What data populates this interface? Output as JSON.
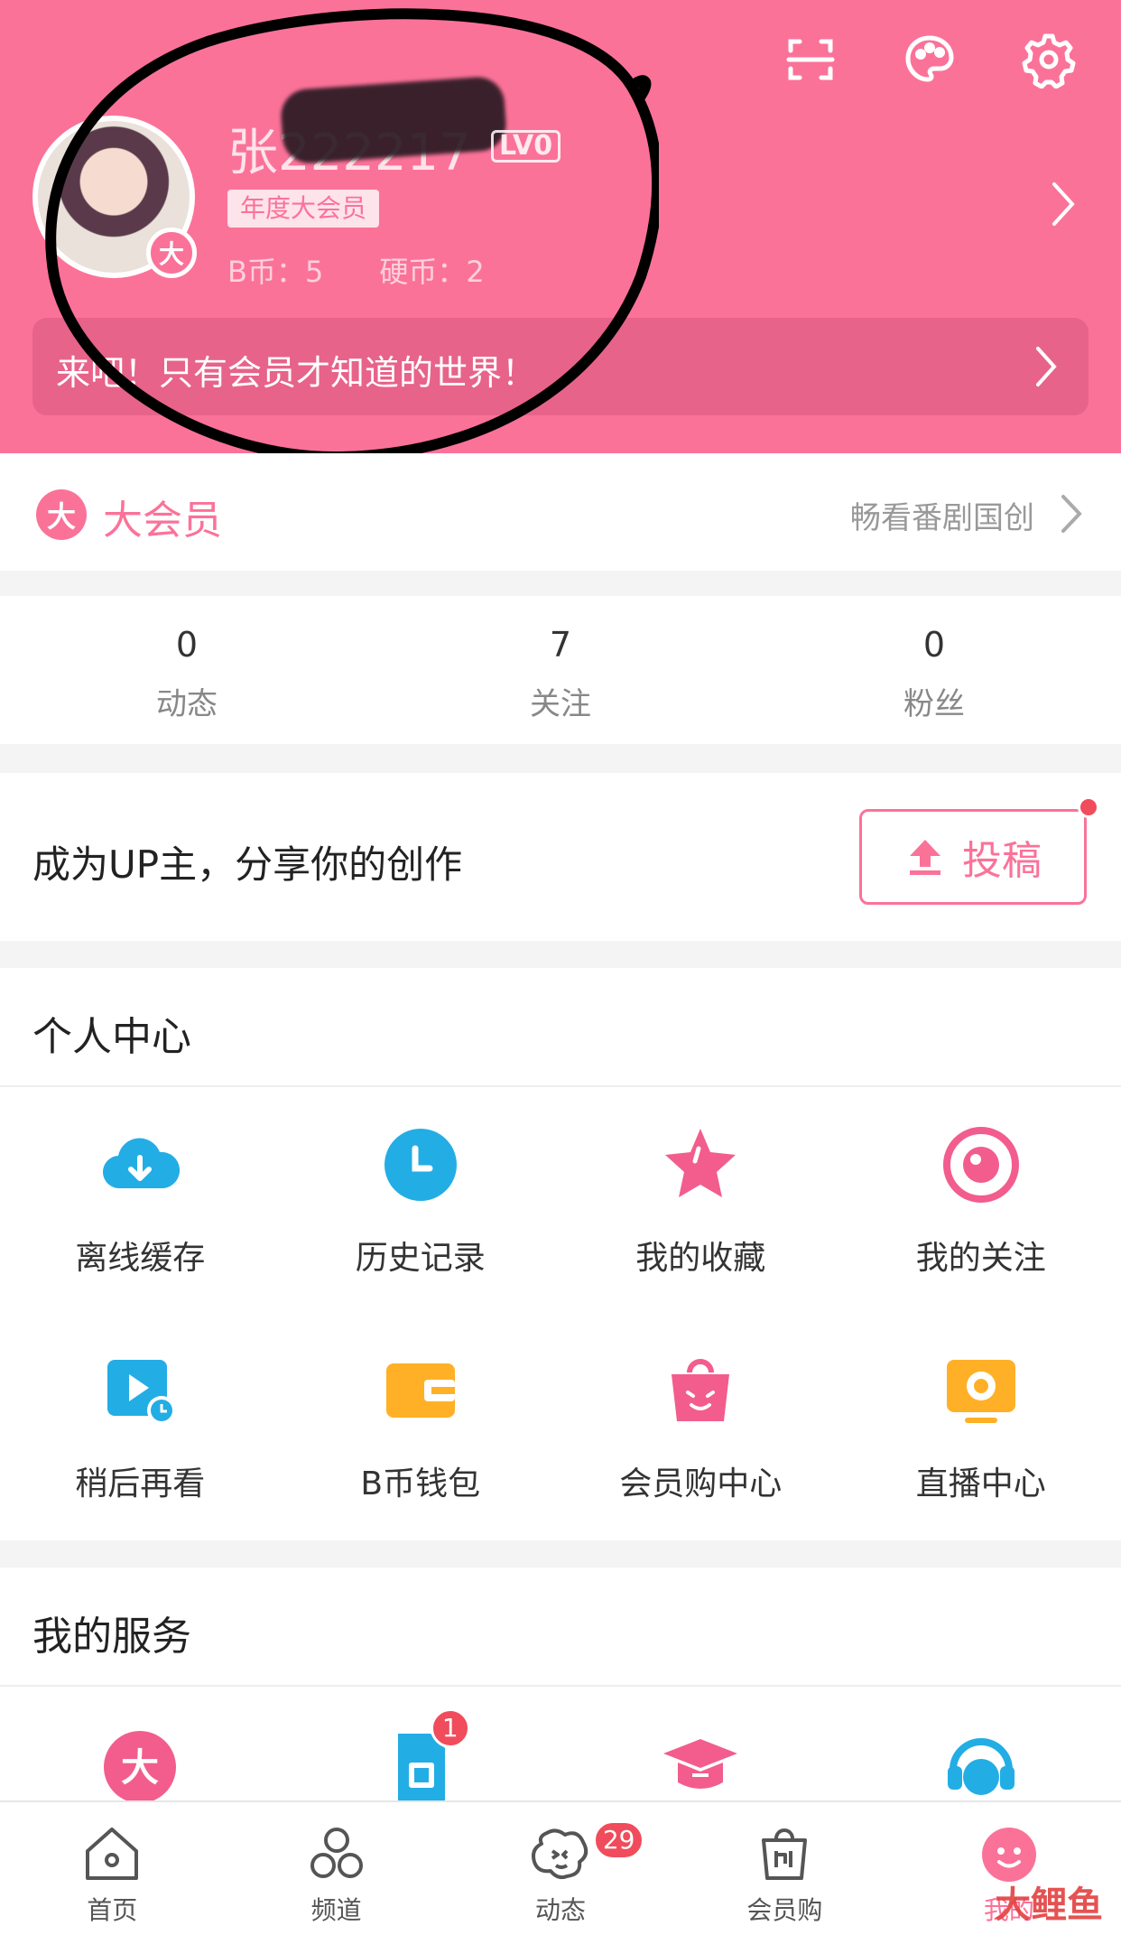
{
  "header": {
    "username": "张222217",
    "level": "LV0",
    "vip_tag": "年度大会员",
    "bcoin": "B币：5",
    "hardcoin": "硬币：2",
    "promo": "来吧！只有会员才知道的世界！",
    "avatar_badge": "大"
  },
  "vip_row": {
    "icon_text": "大",
    "title": "大会员",
    "subtitle": "畅看番剧国创"
  },
  "stats": [
    {
      "num": "0",
      "label": "动态"
    },
    {
      "num": "7",
      "label": "关注"
    },
    {
      "num": "0",
      "label": "粉丝"
    }
  ],
  "up": {
    "text": "成为UP主，分享你的创作",
    "button": "投稿"
  },
  "personal": {
    "title": "个人中心",
    "items": [
      {
        "label": "离线缓存",
        "icon": "cloud-download-icon",
        "color": "#23ade5"
      },
      {
        "label": "历史记录",
        "icon": "clock-icon",
        "color": "#23ade5"
      },
      {
        "label": "我的收藏",
        "icon": "star-icon",
        "color": "#f25d8e"
      },
      {
        "label": "我的关注",
        "icon": "target-icon",
        "color": "#f25d8e"
      },
      {
        "label": "稍后再看",
        "icon": "video-later-icon",
        "color": "#23ade5"
      },
      {
        "label": "B币钱包",
        "icon": "wallet-icon",
        "color": "#ffb027"
      },
      {
        "label": "会员购中心",
        "icon": "shopping-bag-icon",
        "color": "#f25d8e"
      },
      {
        "label": "直播中心",
        "icon": "live-icon",
        "color": "#ffb027"
      }
    ]
  },
  "services": {
    "title": "我的服务",
    "items": [
      {
        "icon": "vip-da-icon",
        "color": "#f25d8e"
      },
      {
        "icon": "sim-card-icon",
        "color": "#23ade5",
        "badge": "1"
      },
      {
        "icon": "graduation-cap-icon",
        "color": "#f25d8e"
      },
      {
        "icon": "headset-icon",
        "color": "#23ade5"
      }
    ]
  },
  "tabbar": [
    {
      "label": "首页",
      "icon": "home-icon"
    },
    {
      "label": "频道",
      "icon": "channels-icon"
    },
    {
      "label": "动态",
      "icon": "dynamic-icon",
      "badge": "29"
    },
    {
      "label": "会员购",
      "icon": "shop-icon"
    },
    {
      "label": "我的",
      "icon": "profile-icon",
      "active": true
    }
  ],
  "watermark": "大鲤鱼",
  "colors": {
    "brand_pink": "#fb7299",
    "blue": "#23ade5",
    "yellow": "#ffb027",
    "badge_red": "#f04c5c"
  }
}
